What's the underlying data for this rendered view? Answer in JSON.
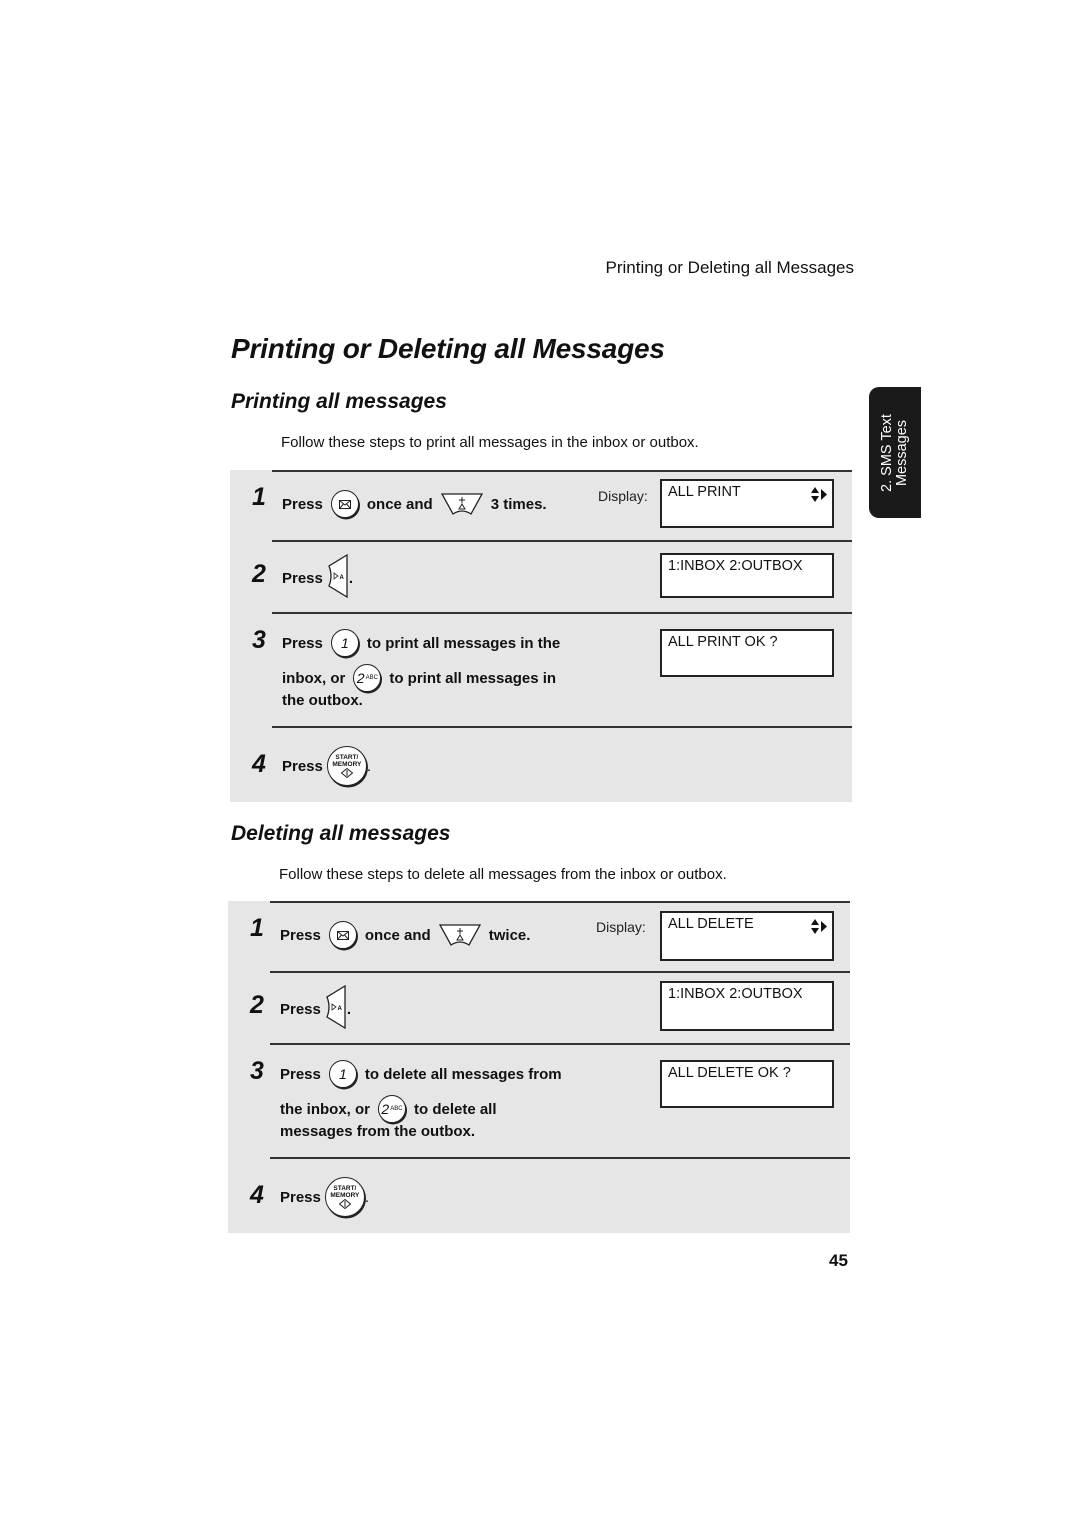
{
  "header": {
    "running_head": "Printing or Deleting all Messages"
  },
  "page_title": "Printing or Deleting all Messages",
  "side_tab": {
    "line1": "2. SMS Text",
    "line2": "Messages"
  },
  "printing": {
    "title": "Printing all messages",
    "intro": "Follow these steps to print all messages in the inbox or outbox.",
    "display_label": "Display:",
    "steps": [
      {
        "number": "1",
        "press": "Press",
        "mid": "once and",
        "end": "3 times.",
        "lcd": "ALL PRINT"
      },
      {
        "number": "2",
        "press": "Press",
        "end": ".",
        "lcd": "1:INBOX 2:OUTBOX"
      },
      {
        "number": "3",
        "press": "Press",
        "text1": "to print all messages in the",
        "text2a": "inbox, or",
        "text2b": "to print all messages in",
        "text3": "the outbox.",
        "lcd": "ALL PRINT OK ?"
      },
      {
        "number": "4",
        "press": "Press",
        "end": "."
      }
    ]
  },
  "deleting": {
    "title": "Deleting all messages",
    "intro": "Follow these steps to delete all messages from the inbox or outbox.",
    "display_label": "Display:",
    "steps": [
      {
        "number": "1",
        "press": "Press",
        "mid": "once and",
        "end": "twice.",
        "lcd": "ALL DELETE"
      },
      {
        "number": "2",
        "press": "Press",
        "end": ".",
        "lcd": "1:INBOX 2:OUTBOX"
      },
      {
        "number": "3",
        "press": "Press",
        "text1": "to delete all messages from",
        "text2a": "the inbox, or",
        "text2b": "to delete all",
        "text3": "messages from the outbox.",
        "lcd": "ALL DELETE OK ?"
      },
      {
        "number": "4",
        "press": "Press",
        "end": "."
      }
    ]
  },
  "keys": {
    "one": "1",
    "two": "2",
    "two_sub": "ABC",
    "start_line1": "START/",
    "start_line2": "MEMORY"
  },
  "page_number": "45"
}
